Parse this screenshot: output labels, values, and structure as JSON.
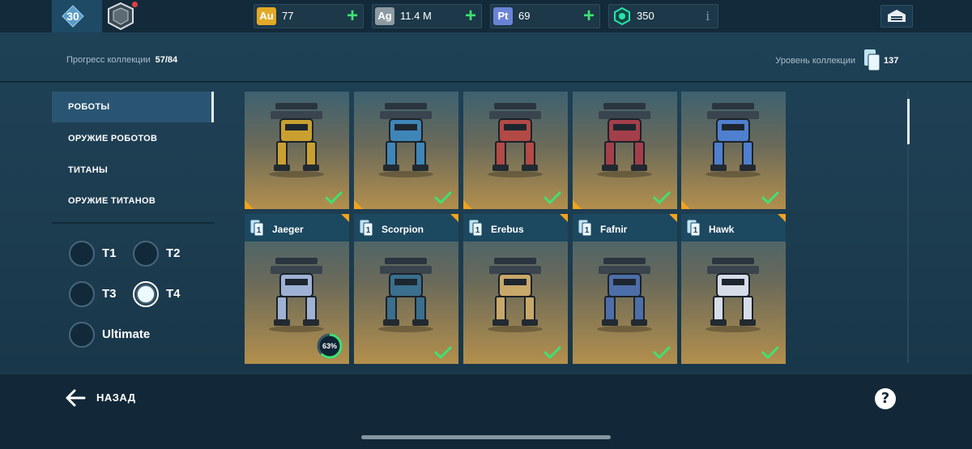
{
  "player": {
    "level": "30"
  },
  "currencies": [
    {
      "icon_text": "Au",
      "icon_color": "#e3a927",
      "value": "77",
      "has_plus": true
    },
    {
      "icon_text": "Ag",
      "icon_color": "#8e9aa3",
      "value": "11.4 M",
      "has_plus": true
    },
    {
      "icon_text": "Pt",
      "icon_color": "#6b83d6",
      "value": "69",
      "has_plus": true
    },
    {
      "icon_text": "",
      "icon_color": "#1fc7a0",
      "value": "350",
      "has_plus": false,
      "info": "i"
    }
  ],
  "header": {
    "progress_label": "Прогресс коллекции",
    "progress_value": "57/84",
    "level_label": "Уровень коллекции",
    "level_value": "137"
  },
  "sidebar": {
    "items": [
      {
        "label": "РОБОТЫ",
        "active": true
      },
      {
        "label": "ОРУЖИЕ РОБОТОВ",
        "active": false
      },
      {
        "label": "ТИТАНЫ",
        "active": false
      },
      {
        "label": "ОРУЖИЕ ТИТАНОВ",
        "active": false
      }
    ],
    "tiers": [
      {
        "label": "T1",
        "checked": false
      },
      {
        "label": "T2",
        "checked": false
      },
      {
        "label": "T3",
        "checked": false
      },
      {
        "label": "T4",
        "checked": true
      },
      {
        "label": "Ultimate",
        "checked": false
      }
    ]
  },
  "robots_row1": [
    {
      "collected": true,
      "palette": "#c9a030"
    },
    {
      "collected": true,
      "palette": "#3f86b8"
    },
    {
      "collected": true,
      "palette": "#b24a45"
    },
    {
      "collected": true,
      "palette": "#a33f4a"
    },
    {
      "collected": true,
      "palette": "#4f7fcf"
    }
  ],
  "robots_row2": [
    {
      "name": "Jaeger",
      "card_count": "1",
      "progress": "63%",
      "progress_fraction": 0.63,
      "collected": false,
      "palette": "#9fb2d4"
    },
    {
      "name": "Scorpion",
      "card_count": "1",
      "collected": true,
      "palette": "#3a6f8d"
    },
    {
      "name": "Erebus",
      "card_count": "1",
      "collected": true,
      "palette": "#c8a86a"
    },
    {
      "name": "Fafnir",
      "card_count": "1",
      "collected": true,
      "palette": "#4d6ea8"
    },
    {
      "name": "Hawk",
      "card_count": "1",
      "collected": true,
      "palette": "#d6dde8"
    }
  ],
  "bottom": {
    "back_label": "НАЗАД",
    "help_label": "?"
  },
  "colors": {
    "accent_green": "#3de272",
    "card_corner": "#f4a21b"
  }
}
